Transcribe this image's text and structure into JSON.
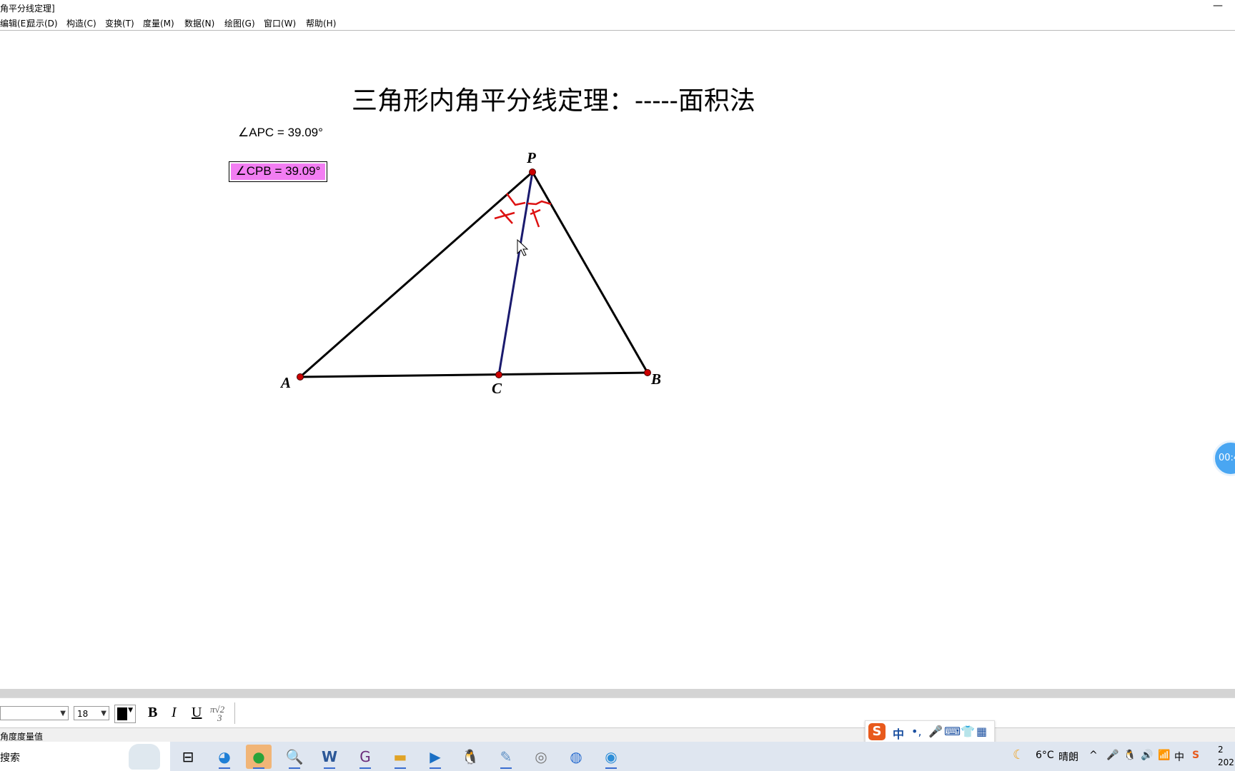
{
  "window": {
    "title": "角平分线定理]",
    "minimize_label": "—"
  },
  "menu": [
    "编辑(E)",
    "显示(D)",
    "构造(C)",
    "变换(T)",
    "度量(M)",
    "数据(N)",
    "绘图(G)",
    "窗口(W)",
    "帮助(H)"
  ],
  "document": {
    "heading": "三角形内角平分线定理：-----面积法",
    "measure_apc": "∠APC = 39.09°",
    "measure_cpb": "∠CPB = 39.09°",
    "points": {
      "A": "A",
      "B": "B",
      "C": "C",
      "P": "P"
    }
  },
  "format_toolbar": {
    "font_size": "18",
    "bold": "B",
    "italic": "I",
    "underline": "U",
    "math_label": "π√2/3"
  },
  "status": {
    "text": "角度度量值"
  },
  "ime": {
    "mode": "中",
    "punct": "•,",
    "logo": "S"
  },
  "timer": {
    "text": "00:4"
  },
  "taskbar": {
    "search_text": "搜索",
    "apps": [
      "task-view",
      "edge",
      "wechat",
      "search-doc",
      "word",
      "geogebra",
      "file-explorer",
      "media",
      "qq",
      "paint",
      "sketchpad",
      "sogou",
      "globe"
    ]
  },
  "tray": {
    "temperature": "6°C",
    "weather": "晴朗",
    "ime_indicator": "中",
    "clock_line1": "2",
    "clock_line2": "202"
  },
  "colors": {
    "point_red": "#cc0000",
    "bisector": "#1a1a6e",
    "highlight_fill": "#f27df2",
    "annotation_red": "#dd1111"
  }
}
